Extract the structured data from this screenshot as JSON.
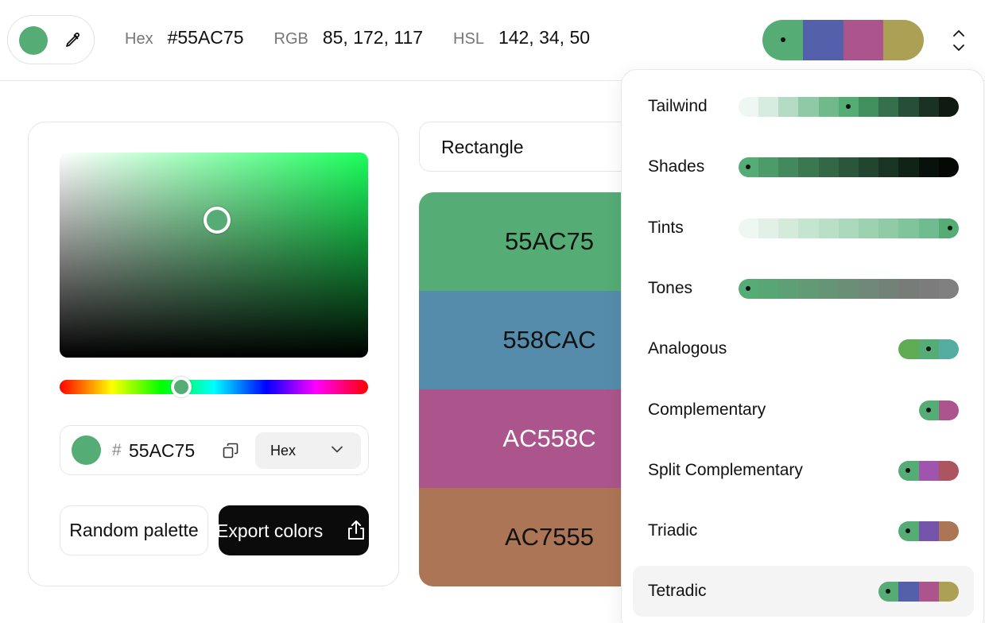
{
  "current": {
    "hex": "#55AC75",
    "hex_value": "55AC75",
    "rgb": "85, 172, 117",
    "hsl": "142, 34, 50",
    "hue": 142,
    "saturation_v": 0.51,
    "value_v": 0.67
  },
  "labels": {
    "hex": "Hex",
    "rgb": "RGB",
    "hsl": "HSL",
    "hash": "#",
    "format": "Hex",
    "random": "Random palette",
    "export": "Export colors",
    "shape": "Rectangle"
  },
  "preview": [
    "#55AC75",
    "#5560AC",
    "#AC558C",
    "#ACA055"
  ],
  "stack": [
    {
      "hex": "55AC75",
      "color": "#55AC75",
      "text": "#111111"
    },
    {
      "hex": "558CAC",
      "color": "#558CAC",
      "text": "#111111"
    },
    {
      "hex": "AC558C",
      "color": "#AC558C",
      "text": "#ffffff"
    },
    {
      "hex": "AC7555",
      "color": "#AC7555",
      "text": "#111111"
    }
  ],
  "harmonies": [
    {
      "name": "Tailwind",
      "active": false,
      "marker": 5,
      "colors": [
        "#eef7f1",
        "#d6ece0",
        "#b3dbc3",
        "#90c9a5",
        "#71b98a",
        "#55ac75",
        "#428f5e",
        "#356f4b",
        "#274f37",
        "#1a3224",
        "#0e1a12"
      ]
    },
    {
      "name": "Shades",
      "active": false,
      "marker": 0,
      "colors": [
        "#55ac75",
        "#4c9b69",
        "#44895d",
        "#3b7852",
        "#336746",
        "#2b563b",
        "#22452f",
        "#1a3423",
        "#112217",
        "#08110b",
        "#050805"
      ]
    },
    {
      "name": "Tints",
      "active": false,
      "marker": 10,
      "colors": [
        "#eef7f1",
        "#e1f1e7",
        "#d4ebdc",
        "#c6e5d1",
        "#b9dfc7",
        "#abd9bc",
        "#9dd2b1",
        "#8ecba6",
        "#7fc49b",
        "#6ebc90",
        "#55ac75"
      ]
    },
    {
      "name": "Tones",
      "active": false,
      "marker": 0,
      "colors": [
        "#55ac75",
        "#59a675",
        "#5ea076",
        "#629a76",
        "#669477",
        "#6b8e77",
        "#6f8877",
        "#738278",
        "#787c78",
        "#7c7c7c",
        "#808080"
      ]
    },
    {
      "name": "Analogous",
      "active": false,
      "marker": 1,
      "colors": [
        "#5fac55",
        "#55ac75",
        "#55aca0"
      ]
    },
    {
      "name": "Complementary",
      "active": false,
      "marker": 0,
      "colors": [
        "#55ac75",
        "#ac558c"
      ]
    },
    {
      "name": "Split Complementary",
      "active": false,
      "marker": 0,
      "colors": [
        "#55ac75",
        "#a055ac",
        "#ac5561"
      ]
    },
    {
      "name": "Triadic",
      "active": false,
      "marker": 0,
      "colors": [
        "#55ac75",
        "#7555ac",
        "#ac7555"
      ]
    },
    {
      "name": "Tetradic",
      "active": true,
      "marker": 0,
      "colors": [
        "#55ac75",
        "#5560ac",
        "#ac558c",
        "#aca055"
      ]
    }
  ],
  "icons": {
    "eyedropper": "eyedropper-icon",
    "sort": "chevron-up-down-icon",
    "copy": "copy-icon",
    "format_chevron": "chevron-down-icon",
    "share": "share-icon"
  }
}
